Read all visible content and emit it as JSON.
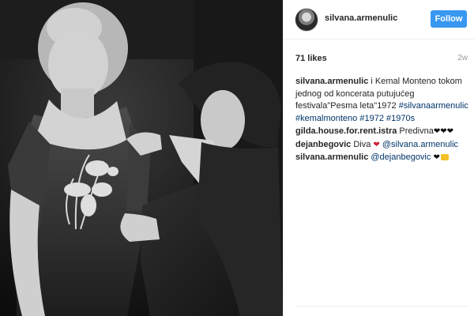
{
  "post": {
    "username": "silvana.armenulic",
    "follow_label": "Follow",
    "likes": "71 likes",
    "time": "2w"
  },
  "caption": {
    "username": "silvana.armenulic",
    "text": " i Kemal Monteno tokom jednog od koncerata putujućeg festivala\"Pesma leta\"1972",
    "hashtags": [
      "#silvanaarmenulic",
      "#kemalmonteno",
      "#1972",
      "#1970s"
    ]
  },
  "comments": [
    {
      "username": "gilda.house.for.rent.istra",
      "text": " Predivna",
      "emoji": [
        "black-heart",
        "black-heart",
        "black-heart"
      ]
    },
    {
      "username": "dejanbegovic",
      "text": " Diva ",
      "mention": "@silvana.armenulic",
      "emoji": [
        "red-heart"
      ]
    },
    {
      "username": "silvana.armenulic",
      "mention": " @dejanbegovic",
      "emoji": [
        "black-heart",
        "ok-hand"
      ]
    }
  ],
  "icons": {
    "heart_black": "❤",
    "heart_red": "❤"
  },
  "colors": {
    "follow_button": "#3897f0",
    "mention": "#003569",
    "photo_bg": "#171717"
  }
}
